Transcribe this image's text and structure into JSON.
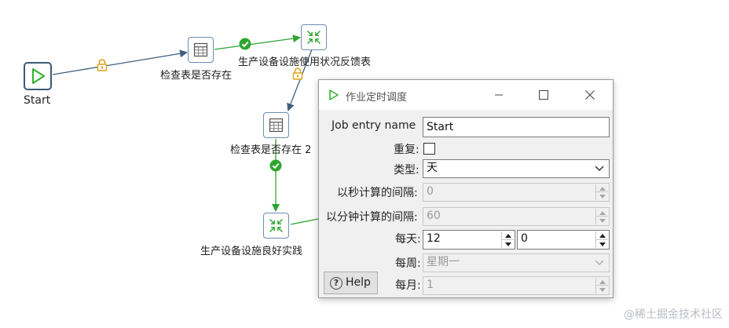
{
  "canvas": {
    "nodes": {
      "start": "Start",
      "check_table_1": "检查表是否存在",
      "check_table_2": "检查表是否存在 2",
      "transform_1": "生产设备设施使用状况反馈表",
      "transform_2": "生产设备设施良好实践"
    }
  },
  "dialog": {
    "title": "作业定时调度",
    "fields": {
      "name_label": "Job entry name",
      "name_value": "Start",
      "repeat_label": "重复:",
      "repeat_checked": false,
      "type_label": "类型:",
      "type_value": "天",
      "seconds_label": "以秒计算的间隔:",
      "seconds_value": "0",
      "minutes_label": "以分钟计算的间隔:",
      "minutes_value": "60",
      "daily_label": "每天:",
      "daily_hour": "12",
      "daily_minute": "0",
      "weekly_label": "每周:",
      "weekly_value": "星期一",
      "monthly_label": "每月:",
      "monthly_value": "1"
    },
    "help_label": "Help"
  },
  "watermark": "@稀土掘金技术社区",
  "colors": {
    "hop_blue": "#3f5f7f",
    "hop_green": "#2ea52e",
    "lock_yellow": "#e0a21b",
    "start_green": "#32b233"
  },
  "icons": {
    "start": "play-triangle-icon",
    "table": "table-grid-icon",
    "transform": "arrows-inward-icon",
    "lock": "padlock-icon",
    "check": "check-circle-icon"
  }
}
